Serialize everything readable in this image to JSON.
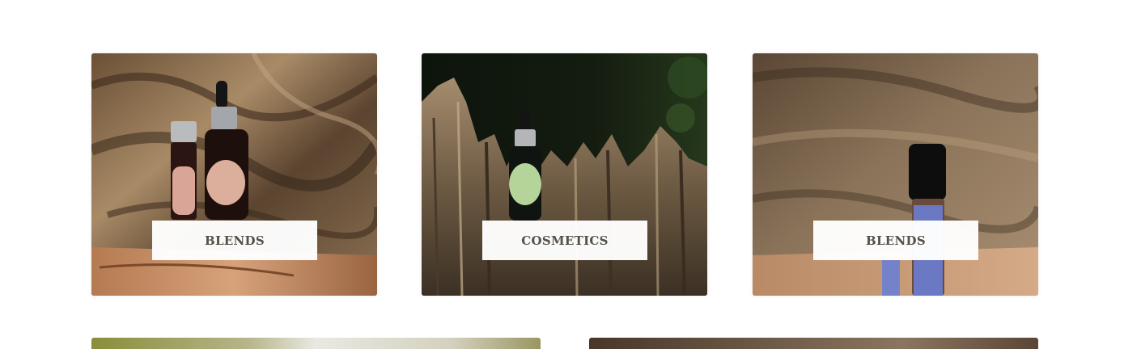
{
  "categories": [
    {
      "label": "BLENDS"
    },
    {
      "label": "COSMETICS"
    },
    {
      "label": "BLENDS"
    }
  ],
  "colors": {
    "label_text": "#555048",
    "label_bg": "#ffffff",
    "page_bg": "#ffffff"
  }
}
